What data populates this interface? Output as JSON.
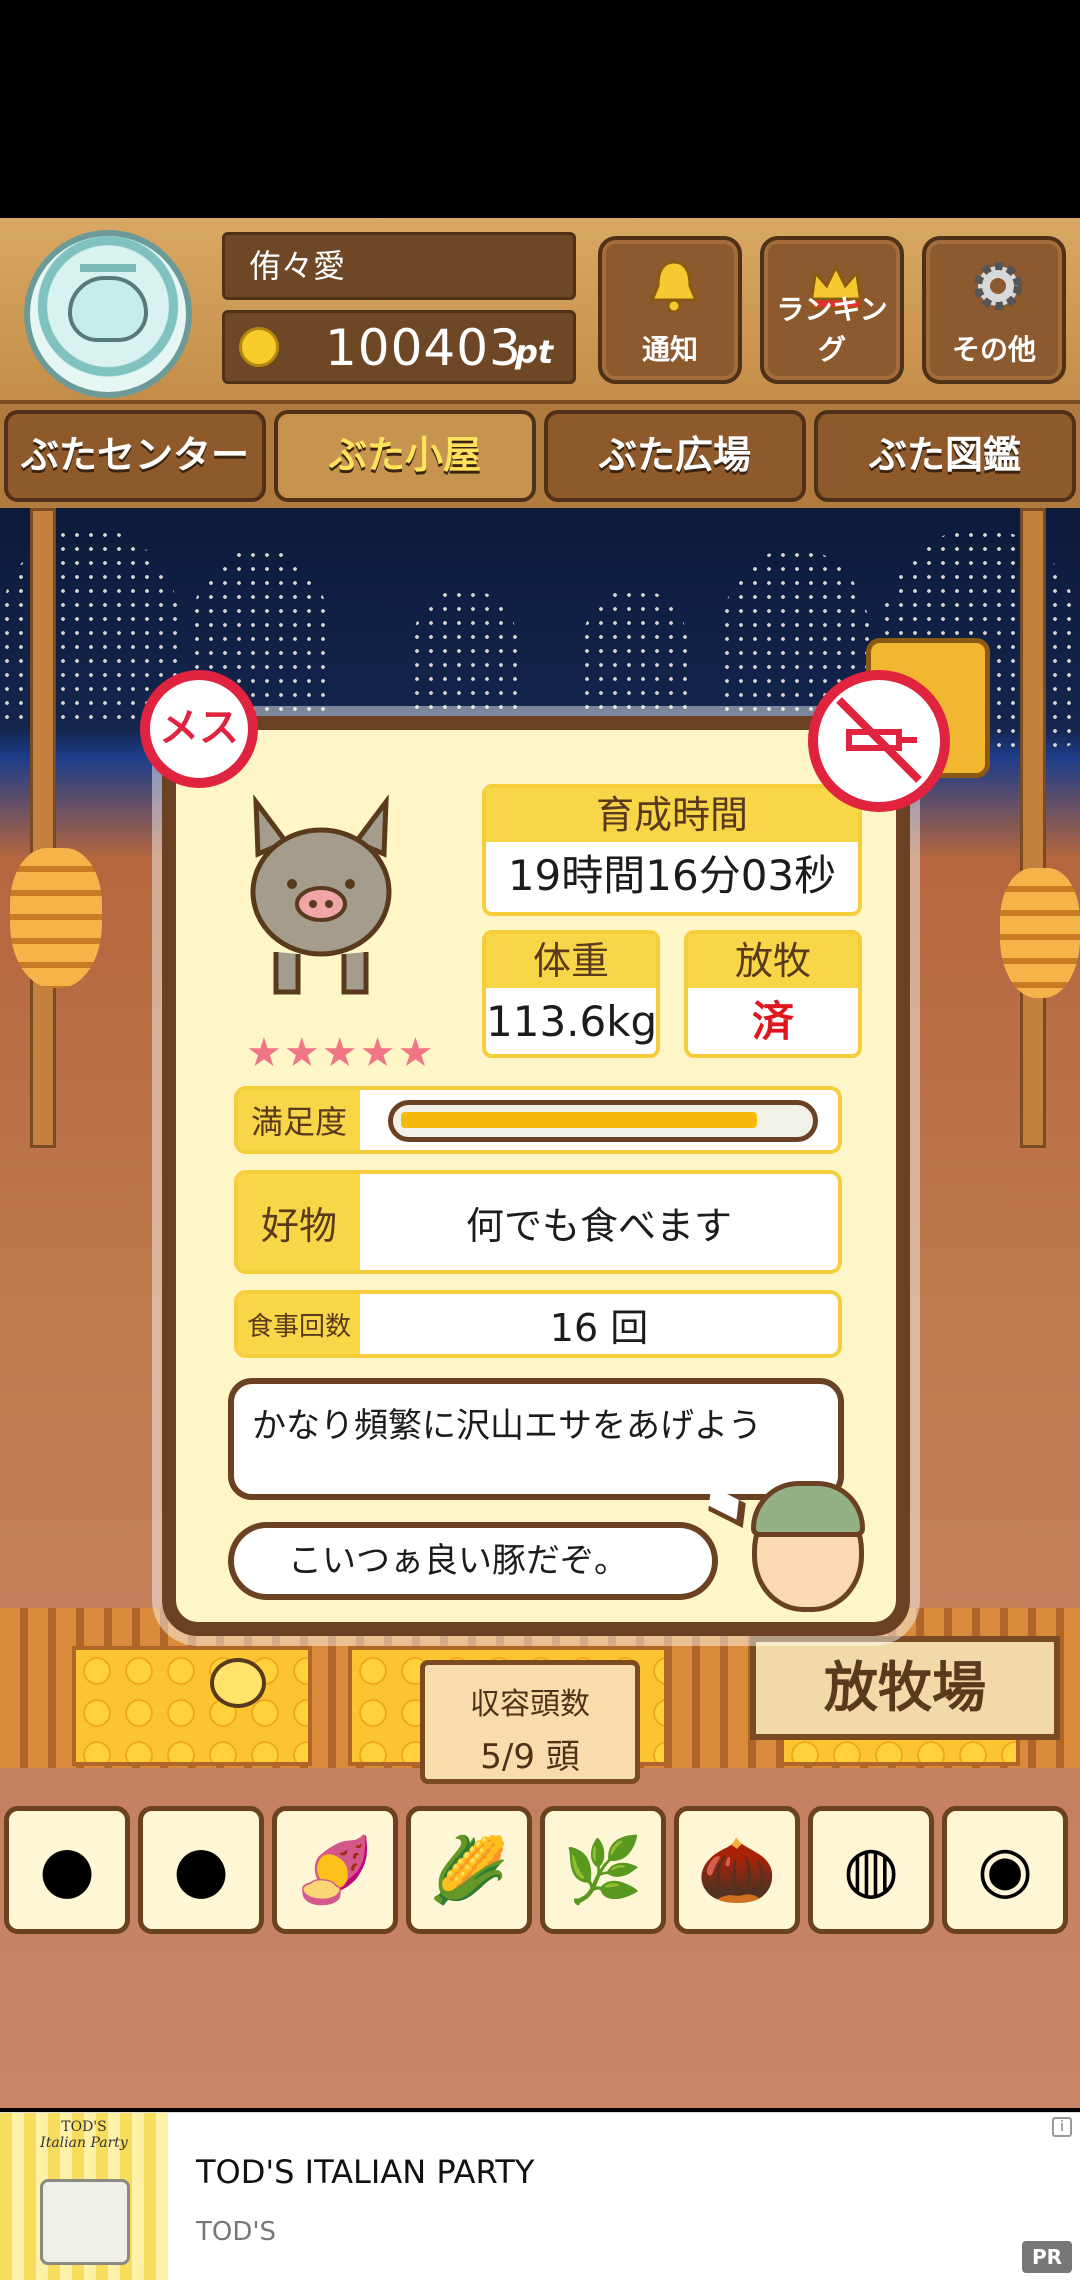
{
  "header": {
    "user_name": "侑々愛",
    "points_value": "100403",
    "points_unit": "pt",
    "buttons": [
      {
        "label": "通知",
        "icon": "bell-icon"
      },
      {
        "label": "ランキング",
        "icon": "crown-icon"
      },
      {
        "label": "その他",
        "icon": "gear-icon"
      }
    ]
  },
  "tabs": [
    {
      "label": "ぶたセンター",
      "active": false
    },
    {
      "label": "ぶた小屋",
      "active": true
    },
    {
      "label": "ぶた広場",
      "active": false
    },
    {
      "label": "ぶた図鑑",
      "active": false
    }
  ],
  "pig": {
    "gender_badge": "メス",
    "stars": "★★★★★",
    "star_count": 5,
    "growth_label": "育成時間",
    "growth_value": "19時間16分03秒",
    "weight_label": "体重",
    "weight_value": "113.6kg",
    "grazing_label": "放牧",
    "grazing_value": "済",
    "satisfaction_label": "満足度",
    "satisfaction_level": 0.88,
    "favorite_label": "好物",
    "favorite_value": "何でも食べます",
    "meals_label": "食事回数",
    "meals_value": "16 回",
    "advice": "かなり頻繁に沢山エサをあげよう",
    "comment": "こいつぁ良い豚だぞ。"
  },
  "barn": {
    "capacity_label": "収容頭数",
    "capacity_value": "5/9 頭",
    "pasture_sign": "放牧場"
  },
  "food_items": [
    {
      "icon": "grain-pile-icon"
    },
    {
      "icon": "mixed-grain-icon"
    },
    {
      "icon": "sweet-potato-icon"
    },
    {
      "icon": "corn-icon"
    },
    {
      "icon": "leaves-beans-icon"
    },
    {
      "icon": "acorn-icon"
    },
    {
      "icon": "grain-plate-icon"
    },
    {
      "icon": "meatball-plate-icon"
    }
  ],
  "ad": {
    "title": "TOD'S ITALIAN PARTY",
    "advertiser": "TOD'S",
    "badge": "PR",
    "image_brand": "TOD'S",
    "image_caption": "Italian Party"
  }
}
